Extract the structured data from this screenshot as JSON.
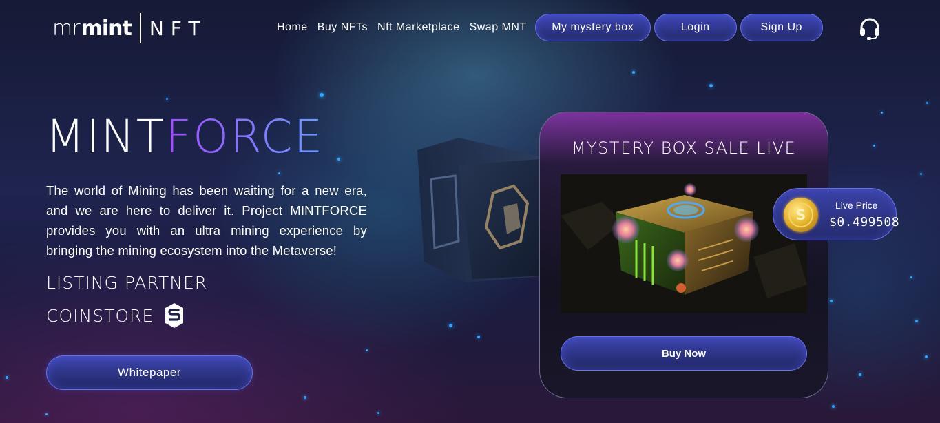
{
  "header": {
    "logo": {
      "part1": "mr",
      "part2": "mint",
      "part3": "NFT"
    },
    "nav": [
      {
        "label": "Home"
      },
      {
        "label": "Buy NFTs"
      },
      {
        "label": "Nft Marketplace"
      },
      {
        "label": "Swap MNT"
      }
    ],
    "mystery_box_label": "My mystery box",
    "login_label": "Login",
    "signup_label": "Sign Up",
    "support_icon": "headset-icon"
  },
  "hero": {
    "title_part1": "MINT",
    "title_part2": "FORCE",
    "description": "The world of Mining has been waiting for a new era, and we are here to deliver it. Project MINTFORCE provides you with an ultra mining experience by bringing the mining ecosystem into the Metaverse!",
    "listing_partner": "LISTING PARTNER",
    "partner_name": "COINSTORE",
    "whitepaper_label": "Whitepaper"
  },
  "card": {
    "title": "MYSTERY BOX SALE LIVE",
    "buy_label": "Buy Now"
  },
  "live_price": {
    "label": "Live Price",
    "value": "$0.499508"
  },
  "colors": {
    "accent": "#6a73e6",
    "title_gradient_start": "#a24bff",
    "title_gradient_end": "#6b9bff",
    "dot": "#2fa7ff"
  }
}
